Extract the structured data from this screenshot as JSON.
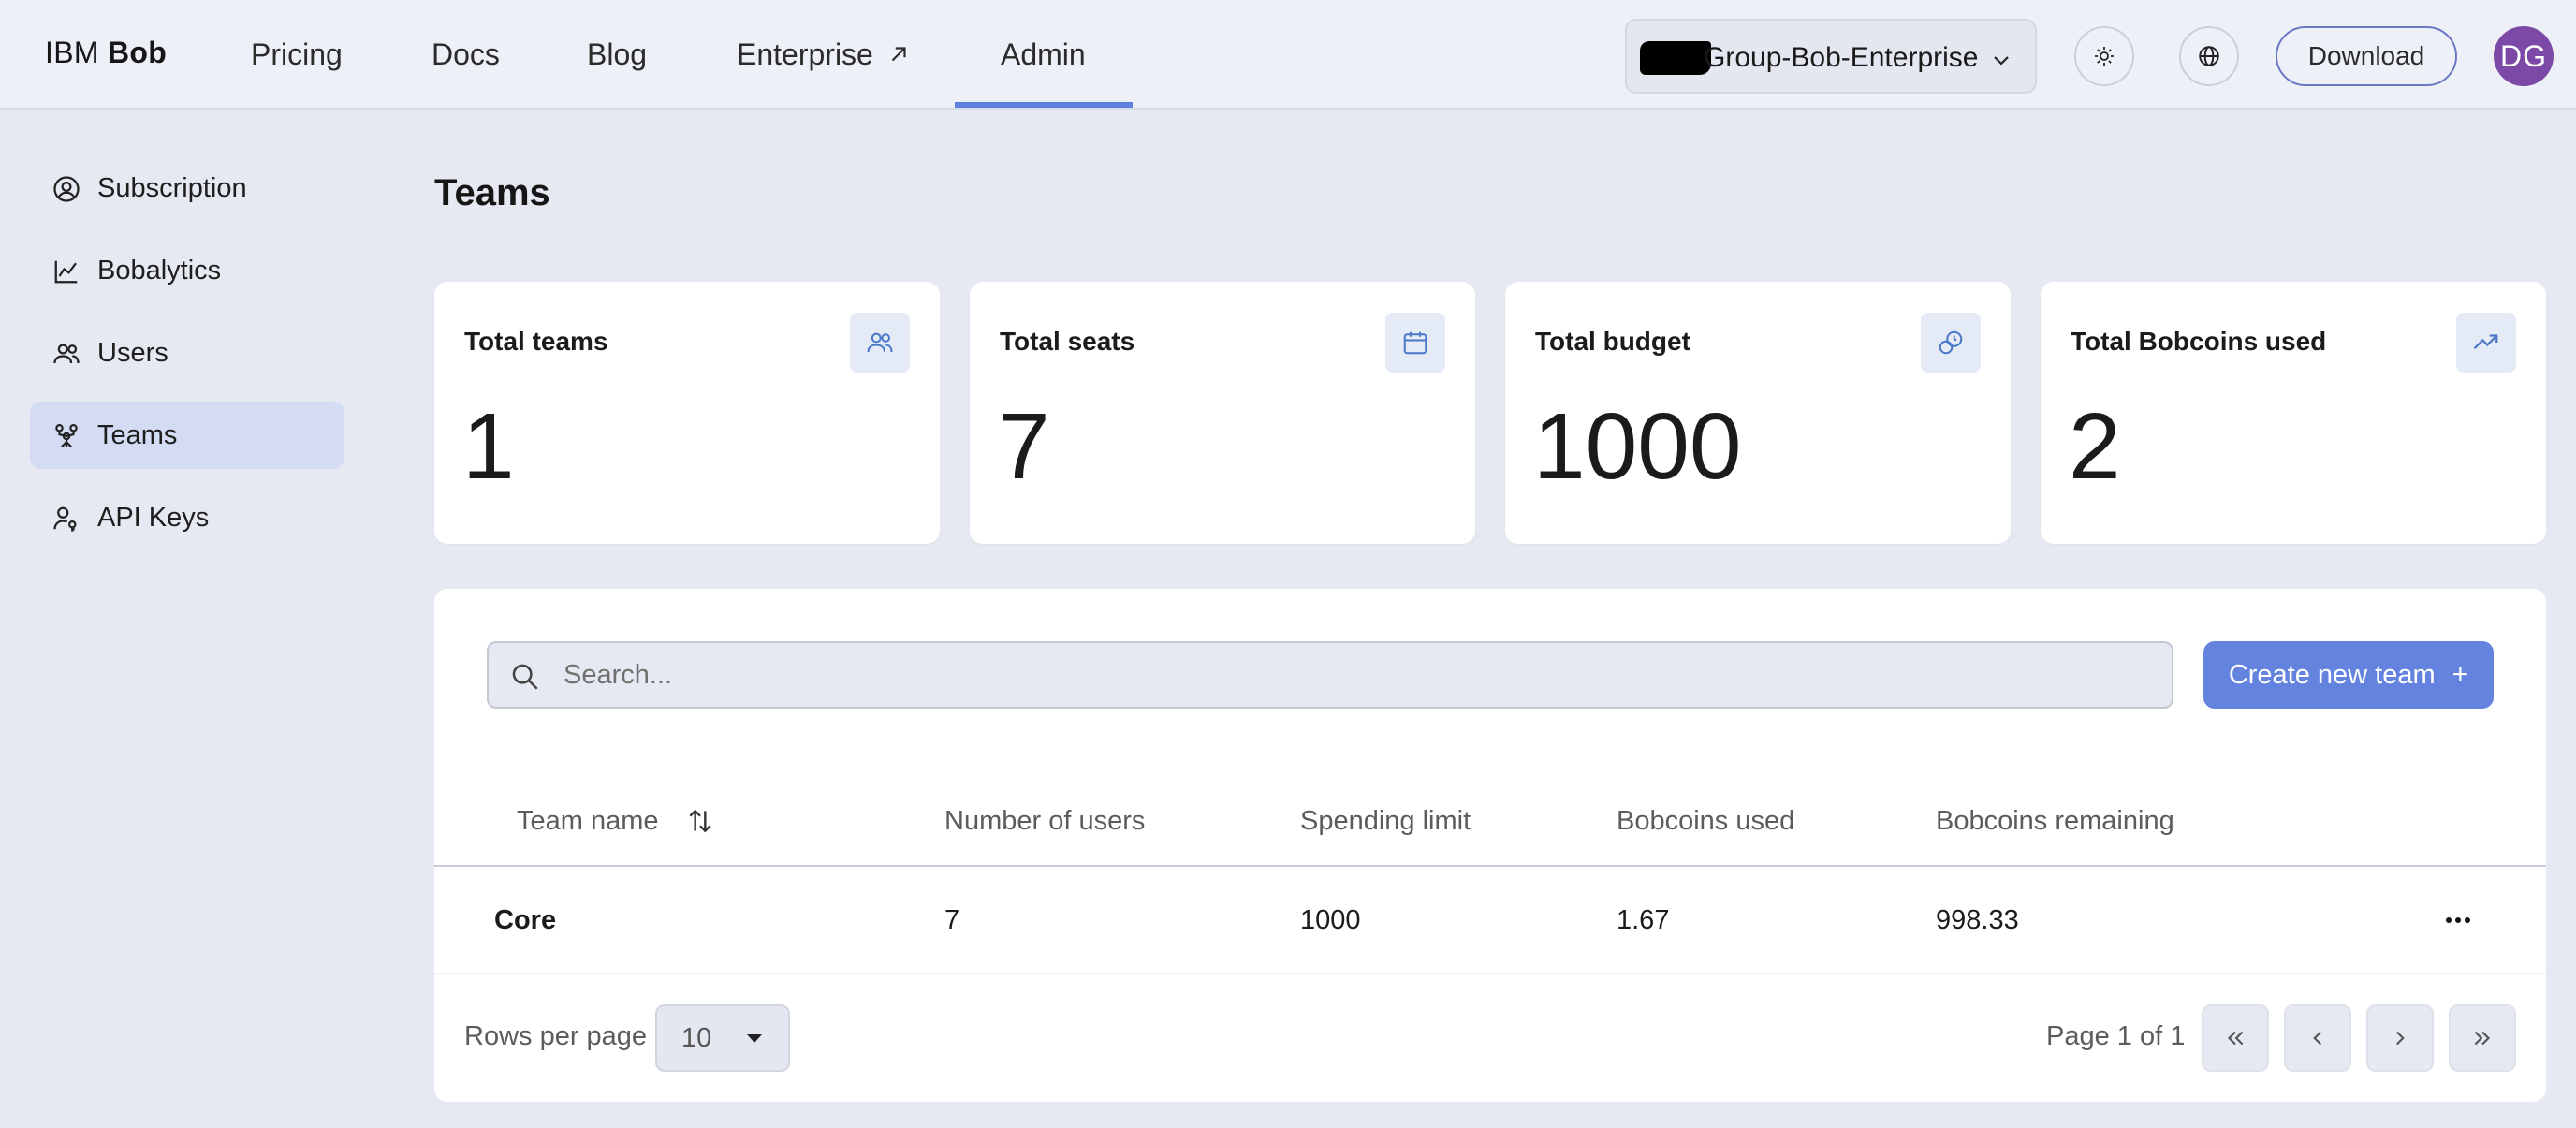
{
  "header": {
    "brand_prefix": "IBM",
    "brand_name": "Bob",
    "nav": [
      {
        "label": "Pricing"
      },
      {
        "label": "Docs"
      },
      {
        "label": "Blog"
      },
      {
        "label": "Enterprise"
      },
      {
        "label": "Admin",
        "active": true
      }
    ],
    "org_selector_label": "Group-Bob-Enterprise",
    "download_label": "Download",
    "avatar_initials": "DG"
  },
  "sidebar": {
    "items": [
      {
        "label": "Subscription",
        "icon": "user-circle-icon"
      },
      {
        "label": "Bobalytics",
        "icon": "chart-line-icon"
      },
      {
        "label": "Users",
        "icon": "users-icon"
      },
      {
        "label": "Teams",
        "icon": "teams-icon",
        "active": true
      },
      {
        "label": "API Keys",
        "icon": "user-key-icon"
      }
    ]
  },
  "page": {
    "title": "Teams"
  },
  "stats": [
    {
      "title": "Total teams",
      "value": "1",
      "icon": "users-icon"
    },
    {
      "title": "Total seats",
      "value": "7",
      "icon": "calendar-icon"
    },
    {
      "title": "Total budget",
      "value": "1000",
      "icon": "coins-icon"
    },
    {
      "title": "Total Bobcoins used",
      "value": "2",
      "icon": "trending-up-icon"
    }
  ],
  "table": {
    "search_placeholder": "Search...",
    "create_label": "Create new team",
    "columns": [
      "Team name",
      "Number of users",
      "Spending limit",
      "Bobcoins used",
      "Bobcoins remaining"
    ],
    "rows": [
      {
        "name": "Core",
        "users": "7",
        "limit": "1000",
        "used": "1.67",
        "remaining": "998.33"
      }
    ],
    "rows_per_page_label": "Rows per page",
    "rows_per_page_value": "10",
    "page_label": "Page 1 of 1"
  },
  "colors": {
    "accent": "#6383df",
    "active_nav_bg": "#d3dcf2",
    "background": "#e6e9f2",
    "avatar": "#7c4aa6"
  }
}
